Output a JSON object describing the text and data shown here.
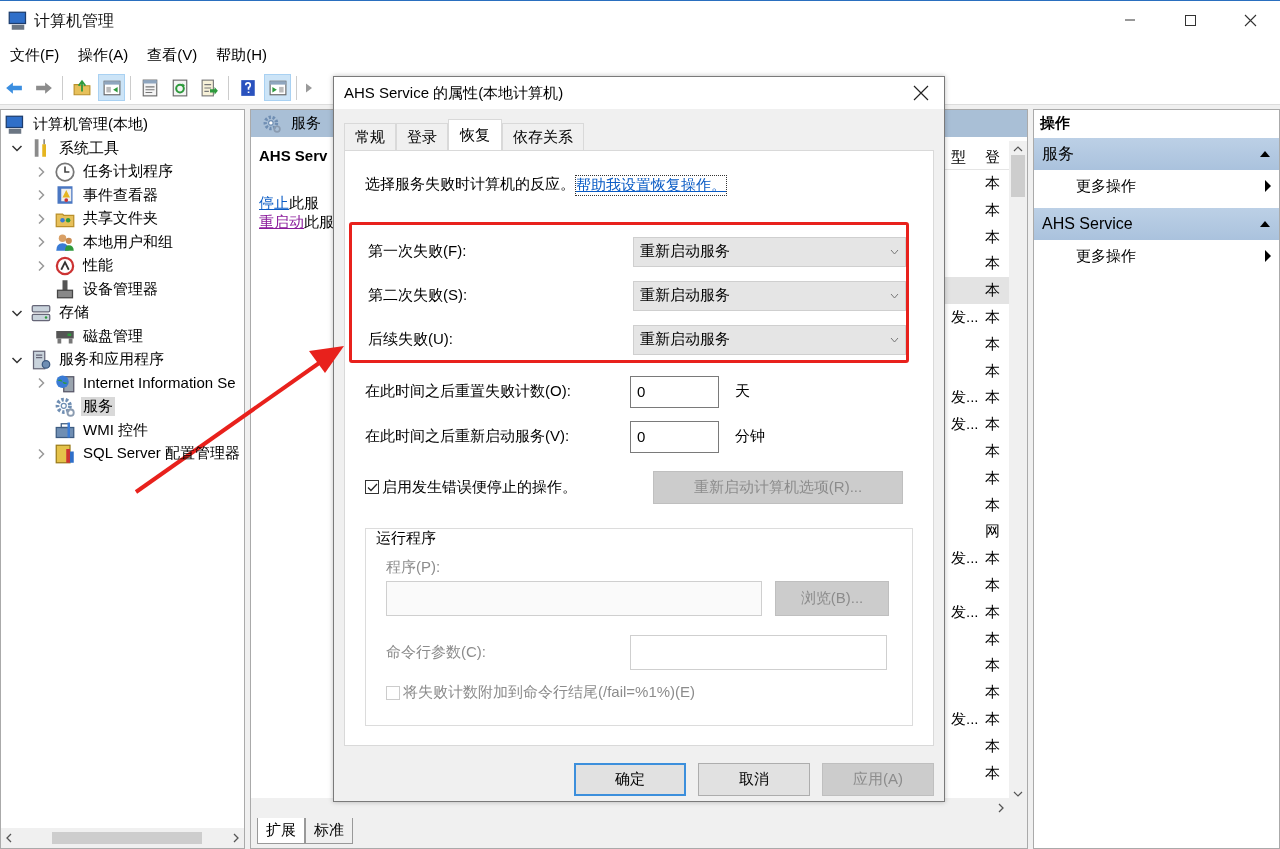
{
  "window": {
    "title": "计算机管理"
  },
  "menu": [
    "文件(F)",
    "操作(A)",
    "查看(V)",
    "帮助(H)"
  ],
  "toolbar": [
    {
      "disabled": false,
      "pressed": false
    },
    {
      "disabled": true,
      "pressed": false
    },
    {
      "disabled": false,
      "pressed": false
    },
    {
      "disabled": false,
      "pressed": true
    },
    {
      "disabled": false,
      "pressed": false
    },
    {
      "disabled": false,
      "pressed": false
    },
    {
      "disabled": false,
      "pressed": false
    },
    {
      "disabled": false,
      "pressed": false
    },
    {
      "disabled": false,
      "pressed": true
    },
    {
      "disabled": true,
      "pressed": false
    }
  ],
  "tree": {
    "label": "计算机管理(本地)",
    "selected": false,
    "children": [
      {
        "label": "系统工具",
        "expanded": true,
        "selected": false,
        "children": [
          {
            "label": "任务计划程序",
            "expanded": false,
            "selected": false
          },
          {
            "label": "事件查看器",
            "expanded": false,
            "selected": false
          },
          {
            "label": "共享文件夹",
            "expanded": false,
            "selected": false
          },
          {
            "label": "本地用户和组",
            "expanded": false,
            "selected": false
          },
          {
            "label": "性能",
            "expanded": false,
            "selected": false
          },
          {
            "label": "设备管理器",
            "selected": false
          }
        ]
      },
      {
        "label": "存储",
        "expanded": true,
        "selected": false,
        "children": [
          {
            "label": "磁盘管理",
            "selected": false
          }
        ]
      },
      {
        "label": "服务和应用程序",
        "expanded": true,
        "selected": false,
        "children": [
          {
            "label": "Internet Information Se",
            "expanded": false,
            "selected": false
          },
          {
            "label": "服务",
            "selected": true
          },
          {
            "label": "WMI 控件",
            "selected": false
          },
          {
            "label": "SQL Server 配置管理器",
            "expanded": false,
            "selected": false
          }
        ]
      }
    ]
  },
  "center_pane": {
    "header": "服务",
    "service_name": "AHS Serv",
    "actions": [
      {
        "link": "停止",
        "text": "此服",
        "visited": false
      },
      {
        "link": "重启动",
        "text": "此服",
        "visited": true
      }
    ]
  },
  "service_list": {
    "columns": [
      "型",
      "登"
    ],
    "rows": [
      {
        "column_2": "本",
        "selected": false
      },
      {
        "column_2": "本",
        "selected": false
      },
      {
        "column_2": "本",
        "selected": false
      },
      {
        "column_2": "本",
        "selected": false
      },
      {
        "column_2": "本",
        "selected": true
      },
      {
        "column_1": "发...",
        "column_2": "本",
        "selected": false
      },
      {
        "column_2": "本",
        "selected": false
      },
      {
        "column_2": "本",
        "selected": false
      },
      {
        "column_1": "发...",
        "column_2": "本",
        "selected": false
      },
      {
        "column_1": "发...",
        "column_2": "本",
        "selected": false
      },
      {
        "column_2": "本",
        "selected": false
      },
      {
        "column_2": "本",
        "selected": false
      },
      {
        "column_2": "本",
        "selected": false
      },
      {
        "column_2": "网",
        "selected": false
      },
      {
        "column_1": "发...",
        "column_2": "本",
        "selected": false
      },
      {
        "column_2": "本",
        "selected": false
      },
      {
        "column_1": "发...",
        "column_2": "本",
        "selected": false
      },
      {
        "column_2": "本",
        "selected": false
      },
      {
        "column_2": "本",
        "selected": false
      },
      {
        "column_2": "本",
        "selected": false
      },
      {
        "column_1": "发...",
        "column_2": "本",
        "selected": false
      },
      {
        "column_2": "本",
        "selected": false
      },
      {
        "column_2": "本",
        "selected": false
      }
    ]
  },
  "bottom_tabs": [
    {
      "label": "扩展",
      "selected": true
    },
    {
      "label": "标准",
      "selected": false
    }
  ],
  "actions_pane": {
    "title": "操作",
    "sections": [
      {
        "title": "服务",
        "expanded": true,
        "items": [
          "更多操作"
        ]
      },
      {
        "title": "AHS Service",
        "expanded": true,
        "items": [
          "更多操作"
        ]
      }
    ]
  },
  "dialog": {
    "title": "AHS Service 的属性(本地计算机)",
    "tabs": [
      {
        "label": "常规",
        "selected": false
      },
      {
        "label": "登录",
        "selected": false
      },
      {
        "label": "恢复",
        "selected": true
      },
      {
        "label": "依存关系",
        "selected": false
      }
    ],
    "intro": "选择服务失败时计算机的反应。",
    "help_link": "帮助我设置恢复操作。",
    "failure_actions": [
      {
        "label": "第一次失败(F):",
        "value": "重新启动服务"
      },
      {
        "label": "第二次失败(S):",
        "value": "重新启动服务"
      },
      {
        "label": "后续失败(U):",
        "value": "重新启动服务"
      }
    ],
    "delays": [
      {
        "label": "在此时间之后重置失败计数(O):",
        "value": "0",
        "unit": "天"
      },
      {
        "label": "在此时间之后重新启动服务(V):",
        "value": "0",
        "unit": "分钟"
      }
    ],
    "stop_on_error": {
      "label": "启用发生错误便停止的操作。",
      "checked": true
    },
    "restart_options_button": {
      "label": "重新启动计算机选项(R)...",
      "disabled": true
    },
    "run_program": {
      "title": "运行程序",
      "disabled": true,
      "program_label": "程序(P):",
      "browse_button": "浏览(B)...",
      "args_label": "命令行参数(C):",
      "append_fail_count": {
        "label": "将失败计数附加到命令行结尾(/fail=%1%)(E)",
        "checked": false
      }
    },
    "buttons": [
      {
        "label": "确定",
        "default": true,
        "disabled": false
      },
      {
        "label": "取消",
        "default": false,
        "disabled": false
      },
      {
        "label": "应用(A)",
        "default": false,
        "disabled": true
      }
    ]
  }
}
